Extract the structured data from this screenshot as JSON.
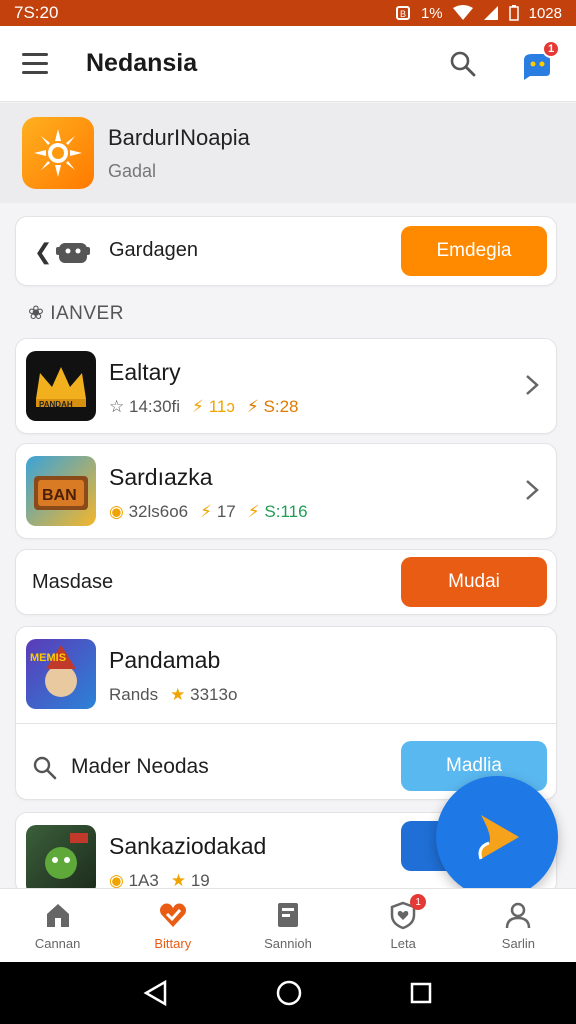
{
  "status_bar": {
    "time": "7S:20",
    "battery_pct": "1%",
    "clock_right": "1028"
  },
  "app_bar": {
    "title": "Nedansia",
    "notification_count": "1"
  },
  "header": {
    "title": "BardurINoapia",
    "subtitle": "Gadal"
  },
  "card_action": {
    "label": "Gardagen",
    "button": "Emdegia"
  },
  "section": {
    "label": "IANVER"
  },
  "items": [
    {
      "title": "Ealtary",
      "meta1": "14:30fi",
      "meta2": "11ɔ",
      "meta3": "S:28"
    },
    {
      "title": "Sardıazka",
      "meta1": "32ls6o6",
      "meta2": "17",
      "meta3": "S:116"
    }
  ],
  "card_mid": {
    "label": "Masdase",
    "button": "Mudai"
  },
  "card_feature": {
    "title": "Pandamab",
    "sub_text": "Rands",
    "rating": "3313o",
    "search_label": "Mader Neodas",
    "button": "Madlia"
  },
  "card_last": {
    "title": "Sankaziodakad",
    "meta1": "1A3",
    "meta2": "19"
  },
  "bottom_nav": [
    {
      "label": "Cannan",
      "icon": "home-icon"
    },
    {
      "label": "Bittary",
      "icon": "heart-check-icon"
    },
    {
      "label": "Sannioh",
      "icon": "document-icon"
    },
    {
      "label": "Leta",
      "icon": "shield-heart-icon",
      "badge": "1"
    },
    {
      "label": "Sarlin",
      "icon": "person-icon"
    }
  ],
  "colors": {
    "accent": "#e85d13",
    "orange": "#ff8a00",
    "blue": "#1e78e6",
    "light_blue": "#5ab8f0",
    "status_bar": "#c2410c"
  }
}
